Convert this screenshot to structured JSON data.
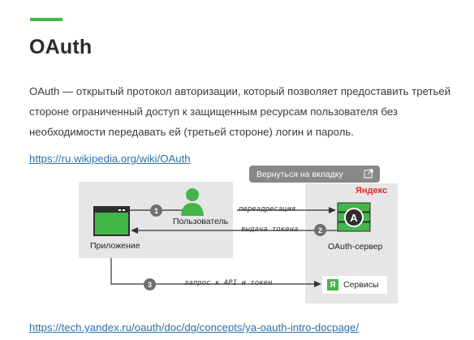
{
  "article": {
    "title": "OAuth",
    "intro": "OAuth — открытый протокол авторизации, который позволяет предоставить третьей стороне ограниченный доступ к защищенным ресурсам пользователя без необходимости передавать ей (третьей стороне) логин и пароль.",
    "wiki_link": "https://ru.wikipedia.org/wiki/OAuth",
    "yandex_link": "https://tech.yandex.ru/oauth/doc/dg/concepts/ya-oauth-intro-docpage/"
  },
  "overlay": {
    "back_to_tab_label": "Вернуться на вкладку",
    "icon": "open-in-new-icon"
  },
  "diagram": {
    "user_label": "Пользователь",
    "app_label": "Приложение",
    "server_label": "OAuth-сервер",
    "yandex_logo": "Яндекс",
    "services_label": "Сервисы",
    "services_icon_letter": "Я",
    "arrows": {
      "redirect": "переадресация",
      "token": "выдача токена",
      "request": "запрос к API и токен"
    },
    "steps": [
      "1",
      "2",
      "3"
    ]
  },
  "colors": {
    "accent": "#43b649",
    "link": "#2f6fa8",
    "yandex_red": "#e3262d",
    "panel": "#e6e6e6"
  }
}
